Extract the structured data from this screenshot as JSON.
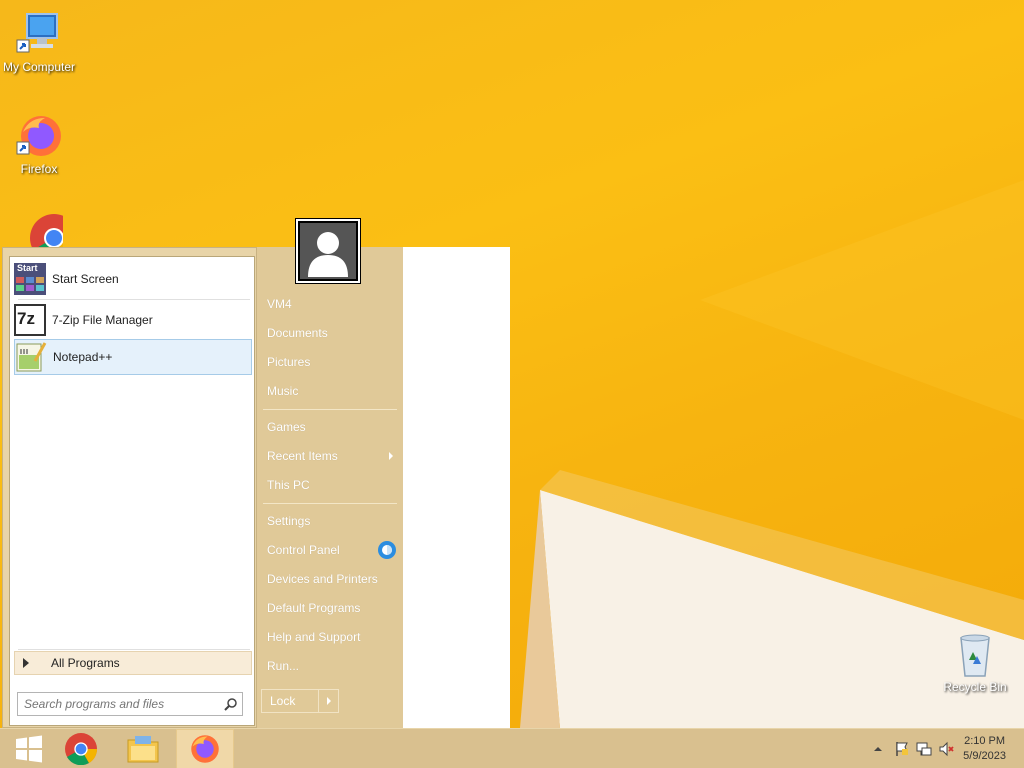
{
  "desktop": {
    "icons": [
      {
        "label": "My Computer",
        "icon": "computer-icon"
      },
      {
        "label": "Firefox",
        "icon": "firefox-icon"
      },
      {
        "label": "",
        "icon": "chrome-icon"
      },
      {
        "label": "Recycle Bin",
        "icon": "recycle-bin-icon"
      }
    ]
  },
  "start_menu": {
    "programs": [
      {
        "label": "Start Screen",
        "icon": "start-screen-icon",
        "icon_text": "Start"
      },
      {
        "label": "7-Zip File Manager",
        "icon": "7zip-icon",
        "icon_text": "7z"
      },
      {
        "label": "Notepad++",
        "icon": "notepadpp-icon",
        "selected": true
      }
    ],
    "all_programs_label": "All Programs",
    "search_placeholder": "Search programs and files",
    "right_items": [
      {
        "label": "VM4"
      },
      {
        "label": "Documents"
      },
      {
        "label": "Pictures"
      },
      {
        "label": "Music"
      },
      {
        "label": "Games"
      },
      {
        "label": "Recent Items",
        "submenu": true
      },
      {
        "label": "This PC"
      },
      {
        "label": "Settings"
      },
      {
        "label": "Control Panel"
      },
      {
        "label": "Devices and Printers"
      },
      {
        "label": "Default Programs"
      },
      {
        "label": "Help and Support"
      },
      {
        "label": "Run..."
      }
    ],
    "lock_label": "Lock"
  },
  "taskbar": {
    "buttons": [
      {
        "icon": "windows-start-icon"
      },
      {
        "icon": "chrome-icon"
      },
      {
        "icon": "file-explorer-icon"
      },
      {
        "icon": "firefox-icon",
        "active": true
      }
    ],
    "clock": {
      "time": "2:10 PM",
      "date": "5/9/2023"
    }
  },
  "colors": {
    "wallpaper": "#f7b410",
    "start_left": "#e8d4a8",
    "start_right": "#e0c998",
    "taskbar": "#d9c08f",
    "selection": "#e5f1fb"
  }
}
